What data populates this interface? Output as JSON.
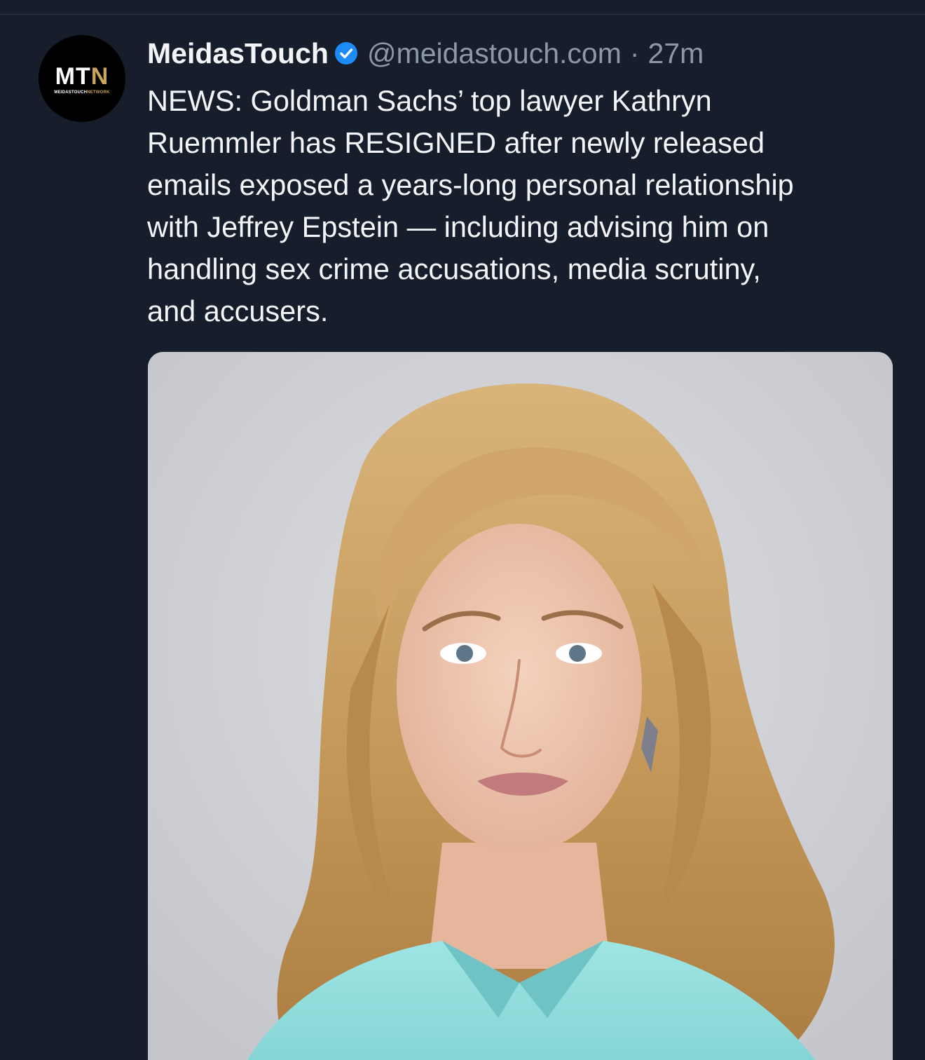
{
  "post": {
    "author": {
      "display_name": "MeidasTouch",
      "handle": "@meidastouch.com",
      "verified": true,
      "avatar": {
        "mark_left": "MT",
        "mark_right": "N",
        "subline_left": "MEIDASTOUCH",
        "subline_right": "NETWORK"
      }
    },
    "separator": "·",
    "timestamp": "27m",
    "text_lines": [
      "NEWS: Goldman Sachs’ top lawyer Kathryn",
      "Ruemmler has RESIGNED after newly released",
      "emails exposed a years-long personal relationship",
      "with Jeffrey Epstein — including advising him on",
      "handling sex crime accusations, media scrutiny,",
      "and accusers."
    ],
    "media": {
      "kind": "photo",
      "icon": "portrait-photo"
    }
  },
  "colors": {
    "background": "#161e2c",
    "text_primary": "#f3f5f8",
    "text_secondary": "#8d97a8",
    "verified_badge": "#1d8cf8",
    "brand_gold": "#c9a45c",
    "photo_backdrop": "#d0d1d6"
  }
}
